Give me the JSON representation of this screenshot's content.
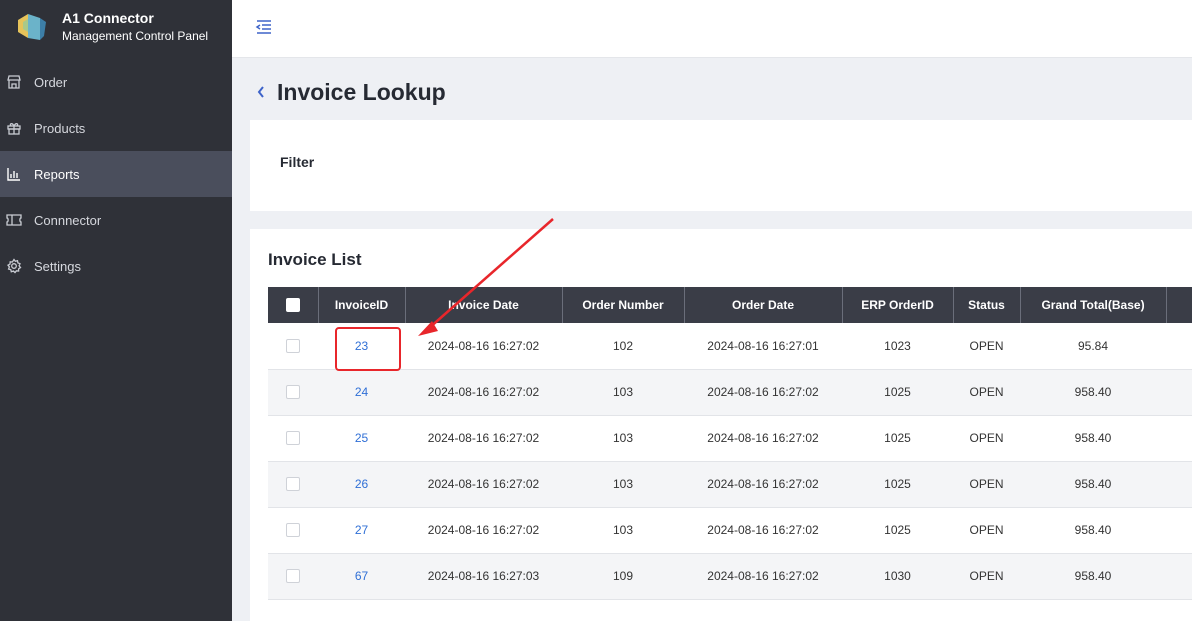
{
  "app": {
    "name": "A1 Connector",
    "subtitle": "Management Control Panel"
  },
  "sidebar": {
    "items": [
      {
        "label": "Order",
        "icon": "store-icon"
      },
      {
        "label": "Products",
        "icon": "gift-icon"
      },
      {
        "label": "Reports",
        "icon": "bar-chart-icon",
        "active": true
      },
      {
        "label": "Connnector",
        "icon": "ticket-icon"
      },
      {
        "label": "Settings",
        "icon": "gear-icon"
      }
    ]
  },
  "page": {
    "title": "Invoice Lookup"
  },
  "filter": {
    "title": "Filter"
  },
  "invoice_list": {
    "title": "Invoice List",
    "columns": [
      "InvoiceID",
      "Invoice Date",
      "Order Number",
      "Order Date",
      "ERP OrderID",
      "Status",
      "Grand Total(Base)"
    ],
    "rows": [
      {
        "invoice_id": "23",
        "invoice_date": "2024-08-16 16:27:02",
        "order_number": "102",
        "order_date": "2024-08-16 16:27:01",
        "erp_order_id": "1023",
        "status": "OPEN",
        "grand_total": "95.84"
      },
      {
        "invoice_id": "24",
        "invoice_date": "2024-08-16 16:27:02",
        "order_number": "103",
        "order_date": "2024-08-16 16:27:02",
        "erp_order_id": "1025",
        "status": "OPEN",
        "grand_total": "958.40"
      },
      {
        "invoice_id": "25",
        "invoice_date": "2024-08-16 16:27:02",
        "order_number": "103",
        "order_date": "2024-08-16 16:27:02",
        "erp_order_id": "1025",
        "status": "OPEN",
        "grand_total": "958.40"
      },
      {
        "invoice_id": "26",
        "invoice_date": "2024-08-16 16:27:02",
        "order_number": "103",
        "order_date": "2024-08-16 16:27:02",
        "erp_order_id": "1025",
        "status": "OPEN",
        "grand_total": "958.40"
      },
      {
        "invoice_id": "27",
        "invoice_date": "2024-08-16 16:27:02",
        "order_number": "103",
        "order_date": "2024-08-16 16:27:02",
        "erp_order_id": "1025",
        "status": "OPEN",
        "grand_total": "958.40"
      },
      {
        "invoice_id": "67",
        "invoice_date": "2024-08-16 16:27:03",
        "order_number": "109",
        "order_date": "2024-08-16 16:27:02",
        "erp_order_id": "1030",
        "status": "OPEN",
        "grand_total": "958.40"
      }
    ]
  },
  "colors": {
    "sidebar_bg": "#2f3138",
    "active_item_bg": "#4a4e5c",
    "table_header_bg": "#3a3d47",
    "link": "#2f6fd6",
    "annotation": "#e8262b"
  }
}
